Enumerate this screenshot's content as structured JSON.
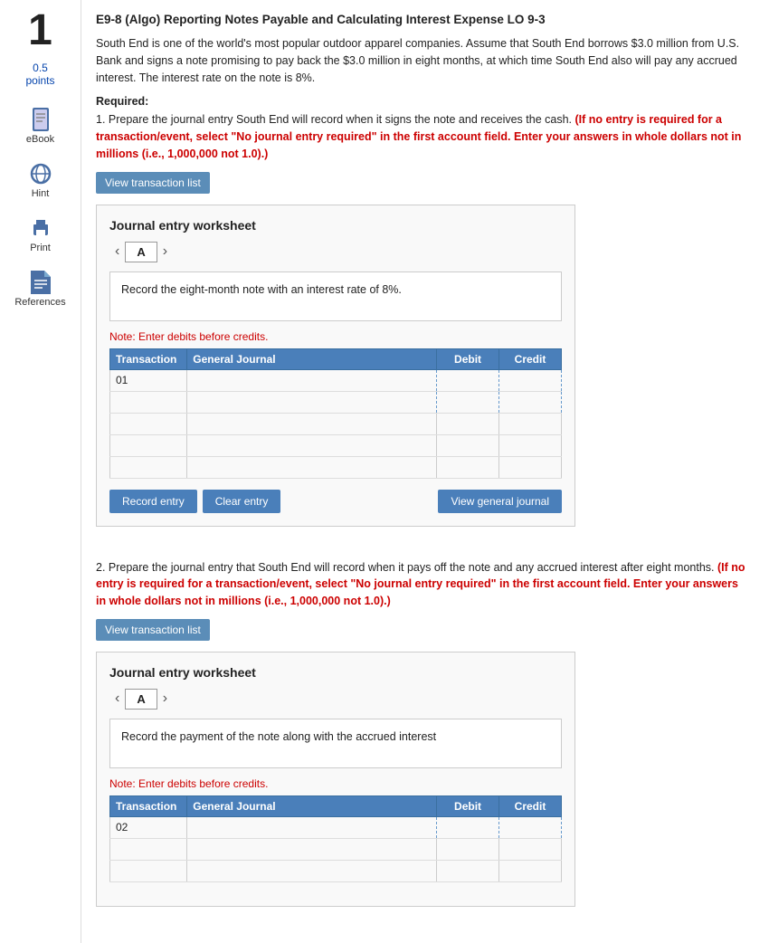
{
  "sidebar": {
    "number": "1",
    "points_label": "0.5",
    "points_text": "points",
    "items": [
      {
        "id": "ebook",
        "label": "eBook",
        "icon": "book"
      },
      {
        "id": "hint",
        "label": "Hint",
        "icon": "globe"
      },
      {
        "id": "print",
        "label": "Print",
        "icon": "print"
      },
      {
        "id": "references",
        "label": "References",
        "icon": "refs"
      }
    ]
  },
  "question": {
    "title": "E9-8 (Algo) Reporting Notes Payable and Calculating Interest Expense LO 9-3",
    "body": "South End is one of the world's most popular outdoor apparel companies. Assume that South End borrows $3.0 million from U.S. Bank and signs a note promising to pay back the $3.0 million in eight months, at which time South End also will pay any accrued interest. The interest rate on the note is 8%.",
    "required_label": "Required:",
    "required_1_plain": "1. Prepare the journal entry South End will record when it signs the note and receives the cash.",
    "required_1_red": "(If no entry is required for a transaction/event, select \"No journal entry required\" in the first account field. Enter your answers in whole dollars not in millions (i.e., 1,000,000 not 1.0).)",
    "view_transaction_label": "View transaction list",
    "worksheet_1": {
      "title": "Journal entry worksheet",
      "tab": "A",
      "note_text": "Record the eight-month note with an interest rate of 8%.",
      "note_enter": "Note: Enter debits before credits.",
      "table": {
        "headers": [
          "Transaction",
          "General Journal",
          "Debit",
          "Credit"
        ],
        "rows": [
          {
            "transaction": "01",
            "journal": "",
            "debit": "",
            "credit": ""
          },
          {
            "transaction": "",
            "journal": "",
            "debit": "",
            "credit": ""
          },
          {
            "transaction": "",
            "journal": "",
            "debit": "",
            "credit": ""
          },
          {
            "transaction": "",
            "journal": "",
            "debit": "",
            "credit": ""
          },
          {
            "transaction": "",
            "journal": "",
            "debit": "",
            "credit": ""
          }
        ]
      },
      "btn_record": "Record entry",
      "btn_clear": "Clear entry",
      "btn_view_journal": "View general journal"
    },
    "required_2_plain": "2. Prepare the journal entry that South End will record when it pays off the note and any accrued interest after eight months.",
    "required_2_red": "(If no entry is required for a transaction/event, select \"No journal entry required\" in the first account field. Enter your answers in whole dollars not in millions (i.e., 1,000,000 not 1.0).)",
    "view_transaction_label_2": "View transaction list",
    "worksheet_2": {
      "title": "Journal entry worksheet",
      "tab": "A",
      "note_text": "Record the payment of the note along with the accrued interest",
      "note_enter": "Note: Enter debits before credits.",
      "table": {
        "headers": [
          "Transaction",
          "General Journal",
          "Debit",
          "Credit"
        ],
        "rows": [
          {
            "transaction": "02",
            "journal": "",
            "debit": "",
            "credit": ""
          },
          {
            "transaction": "",
            "journal": "",
            "debit": "",
            "credit": ""
          },
          {
            "transaction": "",
            "journal": "",
            "debit": "",
            "credit": ""
          }
        ]
      }
    }
  }
}
